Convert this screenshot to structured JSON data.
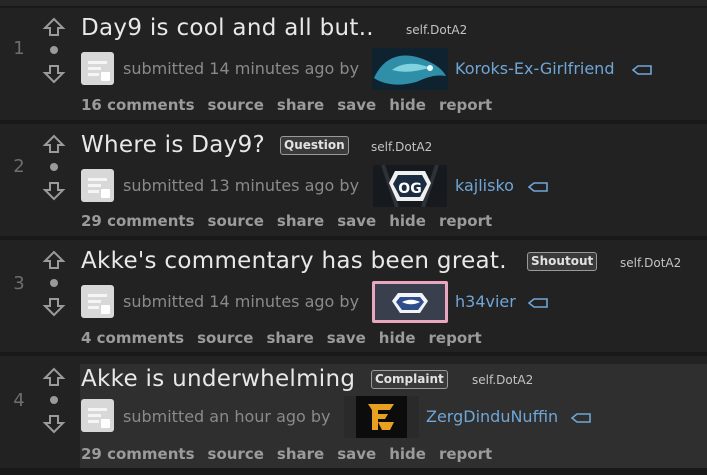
{
  "posts": [
    {
      "rank": "1",
      "title": "Day9 is cool and all but..",
      "flair": "",
      "domain": "self.DotA2",
      "submitted": "submitted 14 minutes ago by",
      "author": "Koroks-Ex-Girlfriend",
      "buttons": [
        "16 comments",
        "source",
        "share",
        "save",
        "hide",
        "report"
      ]
    },
    {
      "rank": "2",
      "title": "Where is Day9?",
      "flair": "Question",
      "domain": "self.DotA2",
      "submitted": "submitted 13 minutes ago by",
      "author": "kajlisko",
      "buttons": [
        "29 comments",
        "source",
        "share",
        "save",
        "hide",
        "report"
      ]
    },
    {
      "rank": "3",
      "title": "Akke's commentary has been great.",
      "flair": "Shoutout",
      "domain": "self.DotA2",
      "submitted": "submitted 14 minutes ago by",
      "author": "h34vier",
      "buttons": [
        "4 comments",
        "source",
        "share",
        "save",
        "hide",
        "report"
      ]
    },
    {
      "rank": "4",
      "title": "Akke is underwhelming",
      "flair": "Complaint",
      "domain": "self.DotA2",
      "submitted": "submitted an hour ago by",
      "author": "ZergDinduNuffin",
      "buttons": [
        "29 comments",
        "source",
        "share",
        "save",
        "hide",
        "report"
      ]
    }
  ],
  "icons": {
    "upvote": "upvote-arrow-icon",
    "downvote": "downvote-arrow-icon",
    "self_post": "self-post-thumbnail-icon",
    "tag": "user-tag-icon"
  },
  "colors": {
    "background": "#191919",
    "post_background": "#222222",
    "title": "#e8e8e8",
    "author_link": "#6fa6d6",
    "buttons": "#9b9b9b"
  }
}
